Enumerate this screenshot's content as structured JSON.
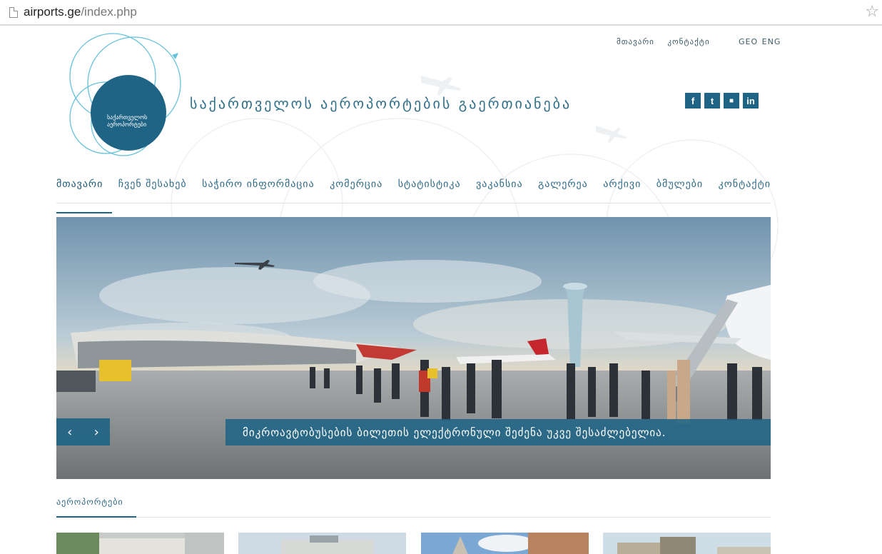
{
  "browser": {
    "url_domain": "airports.ge",
    "url_path": "/index.php",
    "bookmark_icon": "star-outline-icon"
  },
  "header": {
    "title": "საქართველოს აეროპორტების გაერთიანება",
    "logo_text_line1": "საქართველოს",
    "logo_text_line2": "აეროპორტები",
    "top_links": [
      "მთავარი",
      "კონტაქტი"
    ],
    "languages": [
      "GEO",
      "ENG"
    ],
    "social": [
      {
        "icon": "facebook-icon",
        "label": "f"
      },
      {
        "icon": "twitter-icon",
        "label": "t"
      },
      {
        "icon": "youtube-icon",
        "label": "▶"
      },
      {
        "icon": "linkedin-icon",
        "label": "in"
      }
    ],
    "brand_color": "#1f6485"
  },
  "nav": {
    "items": [
      {
        "label": "მთავარი",
        "active": true
      },
      {
        "label": "ჩვენ შესახებ"
      },
      {
        "label": "საჭირო ინფორმაცია"
      },
      {
        "label": "კომერცია"
      },
      {
        "label": "სტატისტიკა"
      },
      {
        "label": "ვაკანსია"
      },
      {
        "label": "გალერეა"
      },
      {
        "label": "არქივი"
      },
      {
        "label": "ბმულები"
      },
      {
        "label": "კონტაქტი"
      }
    ]
  },
  "hero": {
    "caption": "მიკროავტობუსების ბილეთის ელექტრონული შეძენა უკვე შესაძლებელია.",
    "prev": "‹",
    "next": "›"
  },
  "airports_section": {
    "title": "აეროპორტები",
    "thumbnails": [
      "airport-thumb-1",
      "airport-thumb-2",
      "airport-thumb-3",
      "airport-thumb-4"
    ]
  }
}
